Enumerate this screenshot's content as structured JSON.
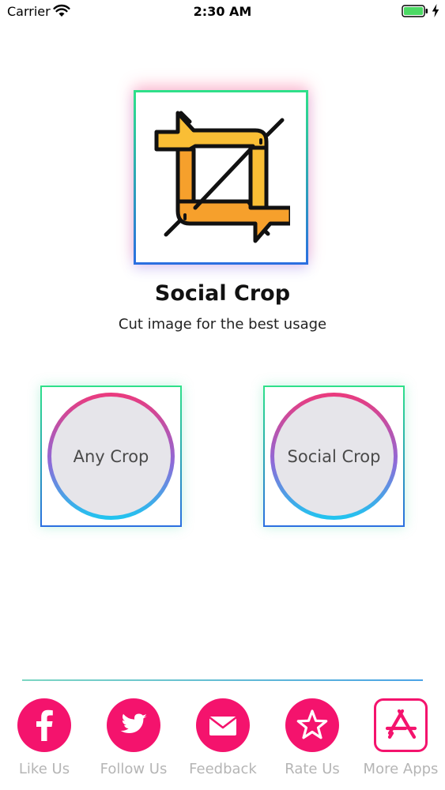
{
  "status_bar": {
    "carrier": "Carrier",
    "time": "2:30 AM"
  },
  "app": {
    "title": "Social Crop",
    "subtitle": "Cut image for the best usage"
  },
  "options": [
    {
      "label": "Any Crop"
    },
    {
      "label": "Social Crop"
    }
  ],
  "footer": {
    "items": [
      {
        "label": "Like Us",
        "icon": "facebook-icon"
      },
      {
        "label": "Follow Us",
        "icon": "twitter-icon"
      },
      {
        "label": "Feedback",
        "icon": "mail-icon"
      },
      {
        "label": "Rate Us",
        "icon": "star-icon"
      },
      {
        "label": "More Apps",
        "icon": "app-store-icon"
      }
    ]
  },
  "colors": {
    "accent": "#f4136d",
    "frame_top": "#2fe08a",
    "frame_bottom": "#2b6fe0",
    "ring_top": "#ec3a7c",
    "ring_bottom": "#1fc6f0",
    "logo_orange": "#f6a02c"
  }
}
